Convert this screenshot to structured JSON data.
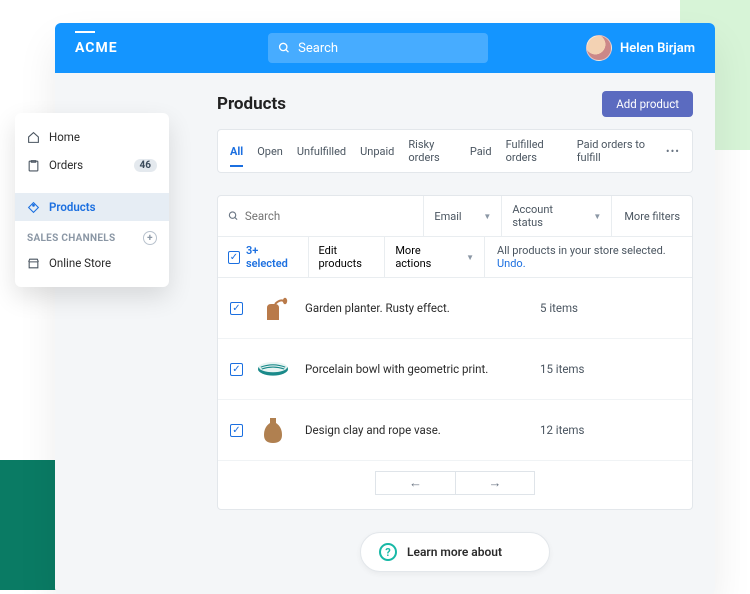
{
  "brand": "ACME",
  "top_search_placeholder": "Search",
  "user_name": "Helen Birjam",
  "sidebar": {
    "items": [
      {
        "label": "Home"
      },
      {
        "label": "Orders",
        "badge": "46"
      },
      {
        "label": "Products"
      }
    ],
    "channels_heading": "SALES CHANNELS",
    "channels": [
      {
        "label": "Online Store"
      }
    ]
  },
  "page_title": "Products",
  "add_button": "Add product",
  "tabs": [
    "All",
    "Open",
    "Unfulfilled",
    "Unpaid",
    "Risky orders",
    "Paid",
    "Fulfilled orders",
    "Paid orders to fulfill"
  ],
  "filters": {
    "search_placeholder": "Search",
    "email": "Email",
    "account_status": "Account status",
    "more": "More filters"
  },
  "selection": {
    "count_label": "3+ selected",
    "edit": "Edit products",
    "more_actions": "More actions",
    "message": "All products in your store selected. ",
    "undo": "Undo."
  },
  "products": [
    {
      "name": "Garden planter. Rusty effect.",
      "qty": "5 items"
    },
    {
      "name": "Porcelain bowl with geometric print.",
      "qty": "15 items"
    },
    {
      "name": "Design clay and rope vase.",
      "qty": "12 items"
    }
  ],
  "learn_more": "Learn more about"
}
